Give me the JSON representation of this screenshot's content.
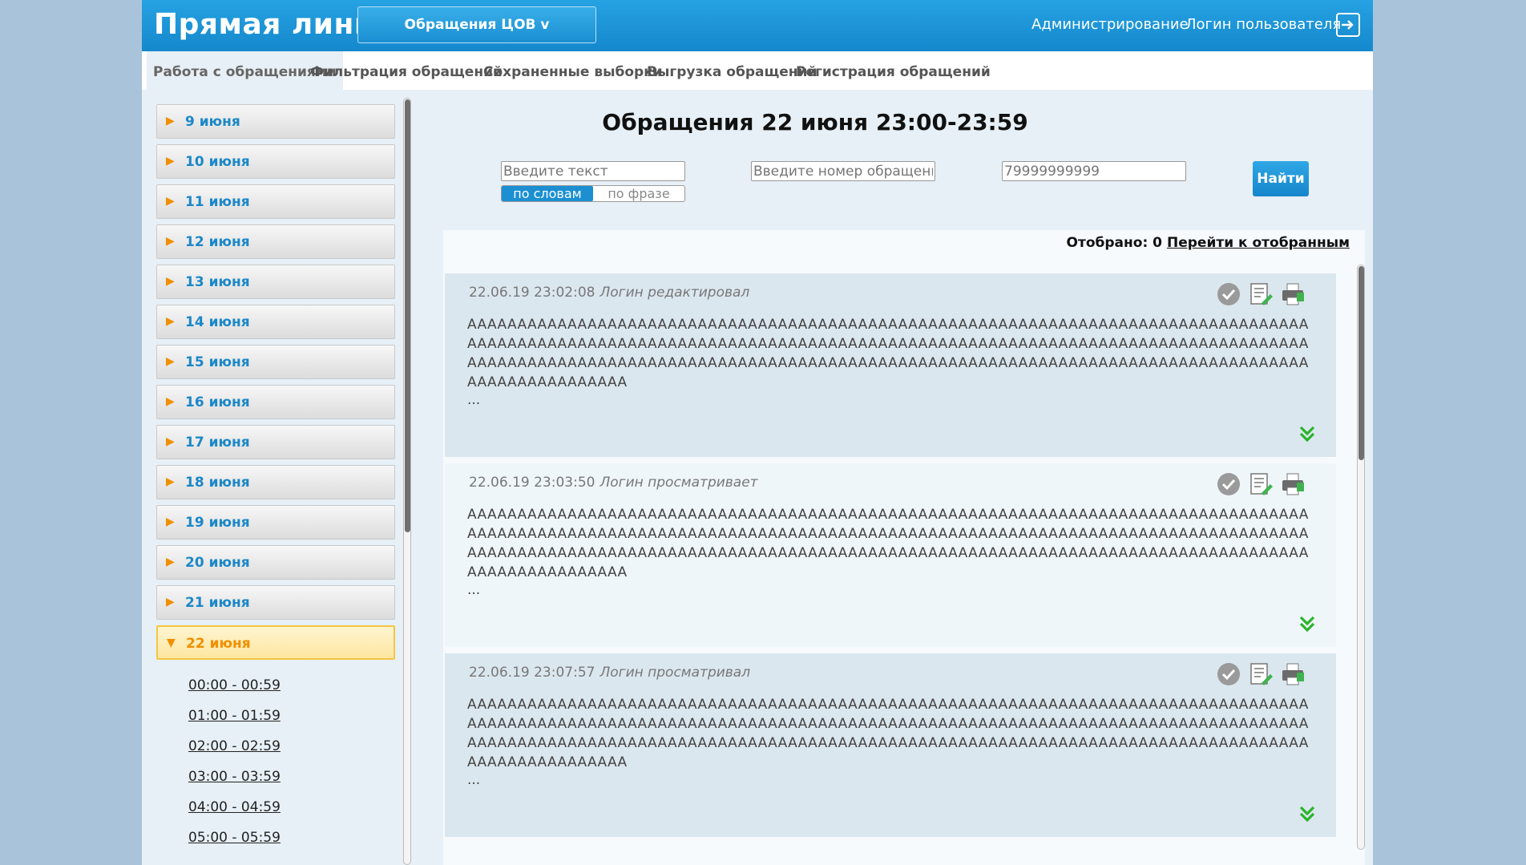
{
  "header": {
    "brand": "Прямая линия",
    "section": "Обращения ЦОВ v",
    "admin": "Администрирование",
    "user": "Логин пользователя"
  },
  "nav": [
    "Работа с обращениями",
    "Фильтрация обращений",
    "Сохраненные выборки",
    "Выгрузка обращений",
    "Регистрация обращений"
  ],
  "sidebar": {
    "days": [
      "9 июня",
      "10 июня",
      "11 июня",
      "12 июня",
      "13 июня",
      "14 июня",
      "15 июня",
      "16 июня",
      "17 июня",
      "18 июня",
      "19 июня",
      "20 июня",
      "21 июня"
    ],
    "open_day": "22 июня",
    "hours": [
      "00:00 - 00:59",
      "01:00 - 01:59",
      "02:00 - 02:59",
      "03:00 - 03:59",
      "04:00 - 04:59",
      "05:00 - 05:59"
    ]
  },
  "main": {
    "title": "Обращения 22 июня 23:00-23:59",
    "search_text_placeholder": "Введите текст",
    "search_number_placeholder": "Введите номер обращения",
    "phone_placeholder": "79999999999",
    "toggle_on": "по словам",
    "toggle_off": "по фразе",
    "find": "Найти",
    "selected_label": "Отобрано: 0",
    "selected_link": "Перейти к отобранным"
  },
  "records": [
    {
      "datetime": "22.06.19 23:02:08",
      "status": "Логин редактировал"
    },
    {
      "datetime": "22.06.19 23:03:50",
      "status": "Логин просматривает"
    },
    {
      "datetime": "22.06.19 23:07:57",
      "status": "Логин просматривал"
    }
  ],
  "record_text": "AAAAAAAAAAAAAAAAAAAAAAAAAAAAAAAAAAAAAAAAAAAAAAAAAAAAAAAAAAAAAAAAAAAAAAAAAAAAAAAAAAAAAAAAAAAAAAAAAAAAAAAAAAAAAAAAAAAAAAAAAAAAAAAAAAAAAAAAAAAAAAAAAAAAAAAAAAAAAAAAAAAAAAAAAAAAAAAAAAAAAAAAAAAAAAAAAAAAAAAAAAAAAAAAAAAAAAAAAAAAAAAAAAAAAAAAAAAAAAAAAAAAAAAAAAAAAAAAAAAAAAAAAAAA",
  "ellipsis": "...",
  "colors": {
    "accent": "#1b8fd2",
    "orange": "#f08f00",
    "link": "#1c88c8"
  }
}
